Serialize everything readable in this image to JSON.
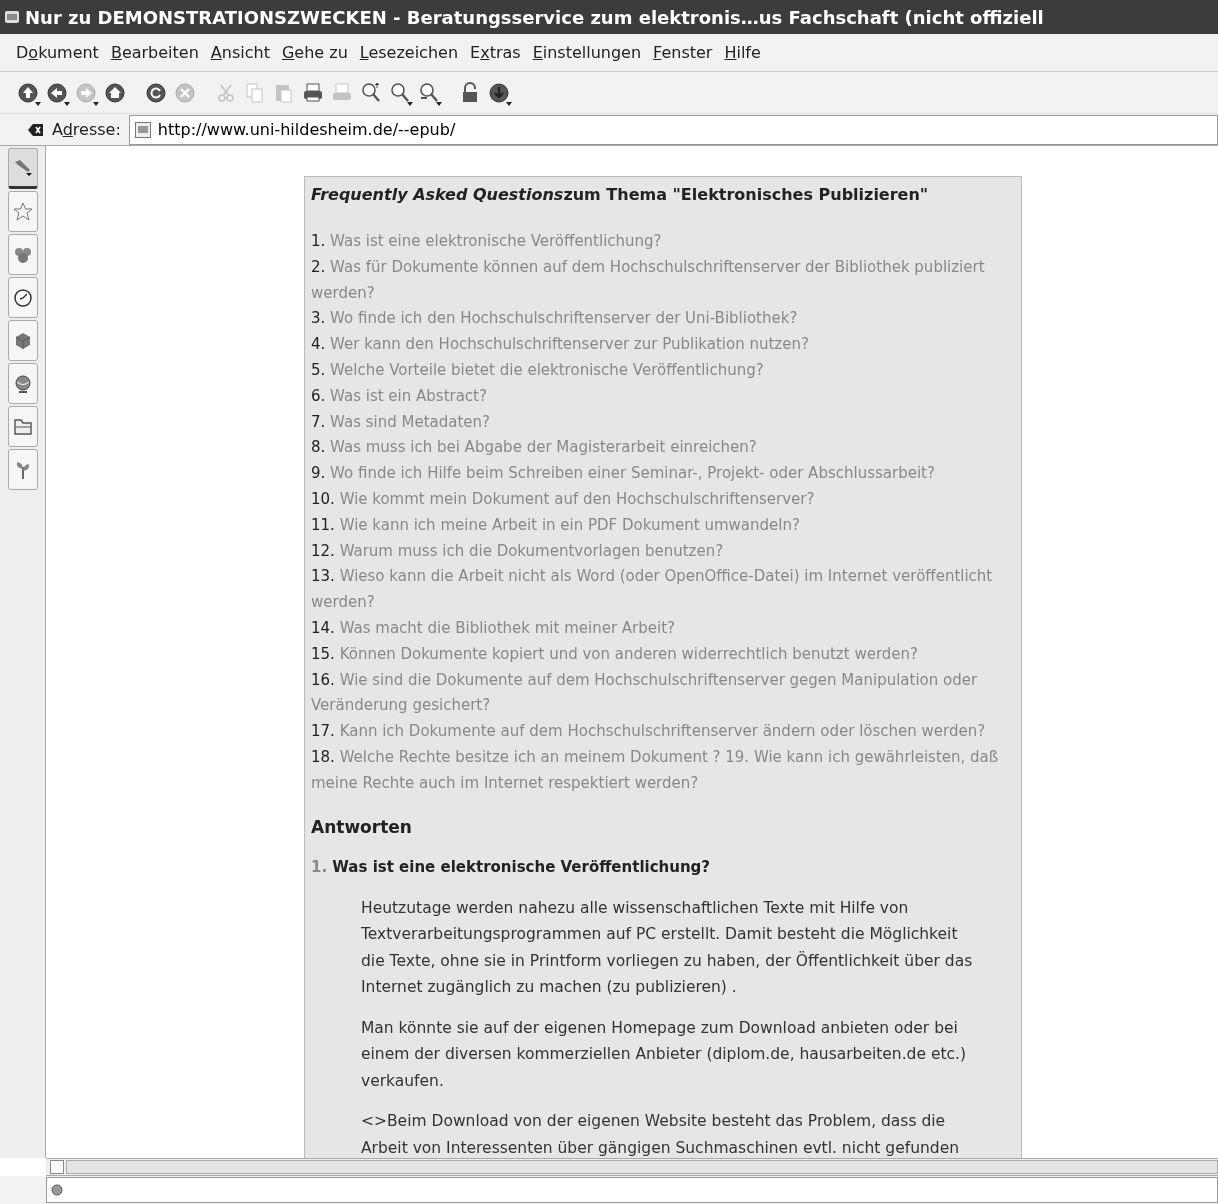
{
  "window": {
    "title": "Nur zu DEMONSTRATIONSZWECKEN - Beratungsservice zum elektronis…us Fachschaft (nicht offiziell"
  },
  "menu": [
    {
      "pre": "D",
      "key": "o",
      "post": "kument"
    },
    {
      "key": "B",
      "post": "earbeiten"
    },
    {
      "key": "A",
      "post": "nsicht"
    },
    {
      "key": "G",
      "post": "ehe zu"
    },
    {
      "key": "L",
      "post": "esezeichen"
    },
    {
      "pre": "E",
      "key": "x",
      "post": "tras"
    },
    {
      "key": "E",
      "post": "instellungen"
    },
    {
      "key": "F",
      "post": "enster"
    },
    {
      "key": "H",
      "post": "ilfe"
    }
  ],
  "toolbar": [
    {
      "buttons": [
        {
          "kind": "up",
          "disabled": false,
          "dropdown": true
        },
        {
          "kind": "back",
          "disabled": false,
          "dropdown": true
        },
        {
          "kind": "forward",
          "disabled": true,
          "dropdown": true
        },
        {
          "kind": "home",
          "disabled": false,
          "dropdown": false
        }
      ]
    },
    {
      "buttons": [
        {
          "kind": "reload",
          "disabled": false,
          "dropdown": false
        },
        {
          "kind": "stop",
          "disabled": true,
          "dropdown": false
        }
      ]
    },
    {
      "buttons": [
        {
          "kind": "cut",
          "disabled": true,
          "dropdown": false
        },
        {
          "kind": "copy",
          "disabled": true,
          "dropdown": false
        },
        {
          "kind": "paste",
          "disabled": true,
          "dropdown": false
        },
        {
          "kind": "print",
          "disabled": false,
          "dropdown": false
        },
        {
          "kind": "printpreview",
          "disabled": true,
          "dropdown": false
        },
        {
          "kind": "zoomin",
          "disabled": false,
          "dropdown": false
        },
        {
          "kind": "zoomout",
          "disabled": false,
          "dropdown": true
        },
        {
          "kind": "zoom",
          "disabled": false,
          "dropdown": true
        }
      ]
    },
    {
      "buttons": [
        {
          "kind": "lock",
          "disabled": false,
          "dropdown": false
        },
        {
          "kind": "download",
          "disabled": false,
          "dropdown": true
        }
      ]
    }
  ],
  "address": {
    "label": {
      "pre": "A",
      "key": "d",
      "post": "resse:"
    },
    "value": "http://www.uni-hildesheim.de/--epub/"
  },
  "sidebar": {
    "tabs": [
      {
        "kind": "tools",
        "selected": true
      },
      {
        "kind": "star",
        "selected": false
      },
      {
        "kind": "group",
        "selected": false
      },
      {
        "kind": "clock",
        "selected": false
      },
      {
        "kind": "cube",
        "selected": false
      },
      {
        "kind": "globe",
        "selected": false
      },
      {
        "kind": "folder",
        "selected": false
      },
      {
        "kind": "plant",
        "selected": false
      }
    ]
  },
  "document": {
    "heading": {
      "emphasis": "Frequently Asked Questions",
      "rest": "zum Thema \"Elektronisches Publizieren\""
    },
    "questions": [
      {
        "number": "1.",
        "text": "Was ist eine elektronische Veröffentlichung?"
      },
      {
        "number": "2.",
        "text": "Was für Dokumente können auf dem Hochschulschriftenserver der Bibliothek publiziert werden?"
      },
      {
        "number": "3.",
        "text": "Wo finde ich den Hochschulschriftenserver der Uni-Bibliothek?"
      },
      {
        "number": "4.",
        "text": "Wer kann den Hochschulschriftenserver zur Publikation nutzen?"
      },
      {
        "number": "5.",
        "text": "Welche Vorteile bietet die elektronische Veröffentlichung?"
      },
      {
        "number": "6.",
        "text": "Was ist ein Abstract?"
      },
      {
        "number": "7.",
        "text": "Was sind Metadaten?"
      },
      {
        "number": "8.",
        "text": "Was muss ich bei Abgabe der Magisterarbeit einreichen?"
      },
      {
        "number": "9.",
        "text": "Wo finde ich Hilfe beim Schreiben einer Seminar-, Projekt- oder Abschlussarbeit?"
      },
      {
        "number": "10.",
        "text": "Wie kommt mein Dokument auf den Hochschulschriftenserver?"
      },
      {
        "number": "11.",
        "text": "Wie kann ich meine Arbeit in ein PDF Dokument umwandeln?"
      },
      {
        "number": "12.",
        "text": "Warum muss ich die Dokumentvorlagen benutzen?"
      },
      {
        "number": "13.",
        "text": "Wieso kann die Arbeit nicht als Word (oder OpenOffice-Datei) im Internet veröffentlicht werden?"
      },
      {
        "number": "14.",
        "text": "Was macht die Bibliothek mit meiner Arbeit?"
      },
      {
        "number": "15.",
        "text": "Können Dokumente kopiert und von anderen widerrechtlich benutzt werden?"
      },
      {
        "number": "16.",
        "text": "Wie sind die Dokumente auf dem Hochschulschriftenserver gegen Manipulation oder Veränderung gesichert?"
      },
      {
        "number": "17.",
        "text": "Kann ich Dokumente auf dem Hochschulschriftenserver ändern oder löschen werden?"
      },
      {
        "number": "18.",
        "text": "Welche Rechte besitze ich an meinem Dokument ? 19. Wie kann ich gewährleisten, daß meine Rechte auch im Internet respektiert werden?"
      }
    ],
    "answers_heading": "Antworten",
    "answers": [
      {
        "number": "1.",
        "question": "Was ist eine elektronische Veröffentlichung?",
        "paragraphs": [
          "Heutzutage werden nahezu alle wissenschaftlichen Texte mit Hilfe von Textverarbeitungsprogrammen auf PC erstellt. Damit besteht die Möglichkeit die Texte, ohne sie in Printform vorliegen zu haben, der Öffentlichkeit über das Internet zugänglich zu machen (zu publizieren) .",
          "Man könnte sie auf der eigenen Homepage zum Download anbieten oder bei einem der diversen kommerziellen Anbieter (diplom.de, hausarbeiten.de etc.) verkaufen.",
          "<>Beim Download von der eigenen Website besteht das Problem, dass die Arbeit von Interessenten über gängigen Suchmaschinen evtl. nicht gefunden"
        ]
      }
    ]
  }
}
